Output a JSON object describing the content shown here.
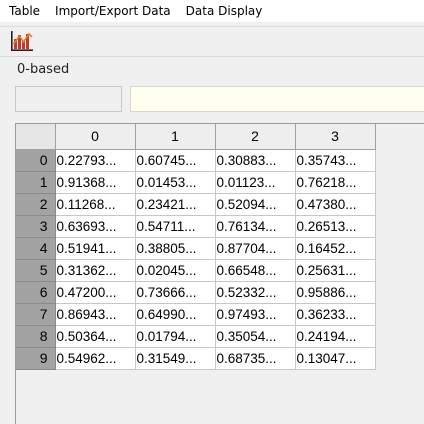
{
  "menu": {
    "items": [
      "Table",
      "Import/Export Data",
      "Data Display"
    ]
  },
  "toolbar": {
    "chart_icon": "bar-chart-icon"
  },
  "index_label": "0-based",
  "cell_reference": "",
  "formula": "",
  "grid": {
    "columns": [
      "0",
      "1",
      "2",
      "3"
    ],
    "rows": [
      {
        "index": "0",
        "cells": [
          "0.22793...",
          "0.60745...",
          "0.30883...",
          "0.35743..."
        ]
      },
      {
        "index": "1",
        "cells": [
          "0.91368...",
          "0.01453...",
          "0.01123...",
          "0.76218..."
        ]
      },
      {
        "index": "2",
        "cells": [
          "0.11268...",
          "0.23421...",
          "0.52094...",
          "0.47380..."
        ]
      },
      {
        "index": "3",
        "cells": [
          "0.63693...",
          "0.54711...",
          "0.76134...",
          "0.26513..."
        ]
      },
      {
        "index": "4",
        "cells": [
          "0.51941...",
          "0.38805...",
          "0.87704...",
          "0.16452..."
        ]
      },
      {
        "index": "5",
        "cells": [
          "0.31362...",
          "0.02045...",
          "0.66548...",
          "0.25631..."
        ]
      },
      {
        "index": "6",
        "cells": [
          "0.47200...",
          "0.73666...",
          "0.52332...",
          "0.95886..."
        ]
      },
      {
        "index": "7",
        "cells": [
          "0.86943...",
          "0.64990...",
          "0.97493...",
          "0.36233..."
        ]
      },
      {
        "index": "8",
        "cells": [
          "0.50364...",
          "0.01794...",
          "0.35054...",
          "0.24194..."
        ]
      },
      {
        "index": "9",
        "cells": [
          "0.54962...",
          "0.31549...",
          "0.68735...",
          "0.13047..."
        ]
      }
    ]
  },
  "colors": {
    "row_header_bg": "#a3a3a3",
    "formula_bar_bg": "#fffff0",
    "window_bg": "#f0f0f0"
  }
}
